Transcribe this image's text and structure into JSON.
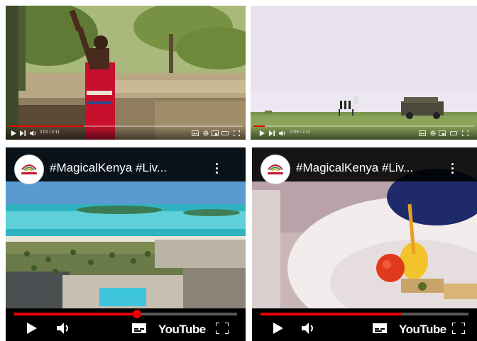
{
  "tiles": [
    {
      "id": "video-1",
      "progress": 0.32,
      "time": "2:01 / 2:11"
    },
    {
      "id": "video-2",
      "progress": 0.05,
      "time": "0:05 / 2:11"
    },
    {
      "id": "video-3",
      "title": "#MagicalKenya #Liv...",
      "logo_text": "Magical Kenya",
      "progress": 0.55,
      "youtube_label": "YouTube"
    },
    {
      "id": "video-4",
      "title": "#MagicalKenya #Liv...",
      "logo_text": "Magical Kenya",
      "progress": 0.68,
      "youtube_label": "YouTube"
    }
  ],
  "icons": {
    "play": "play-icon",
    "next": "next-icon",
    "volume": "volume-icon",
    "settings": "gear-icon",
    "subtitles": "subtitles-icon",
    "fullscreen": "fullscreen-icon",
    "menu": "more-vert-icon"
  },
  "colors": {
    "progress": "#e00000",
    "masai_robe": "#c8102e"
  }
}
